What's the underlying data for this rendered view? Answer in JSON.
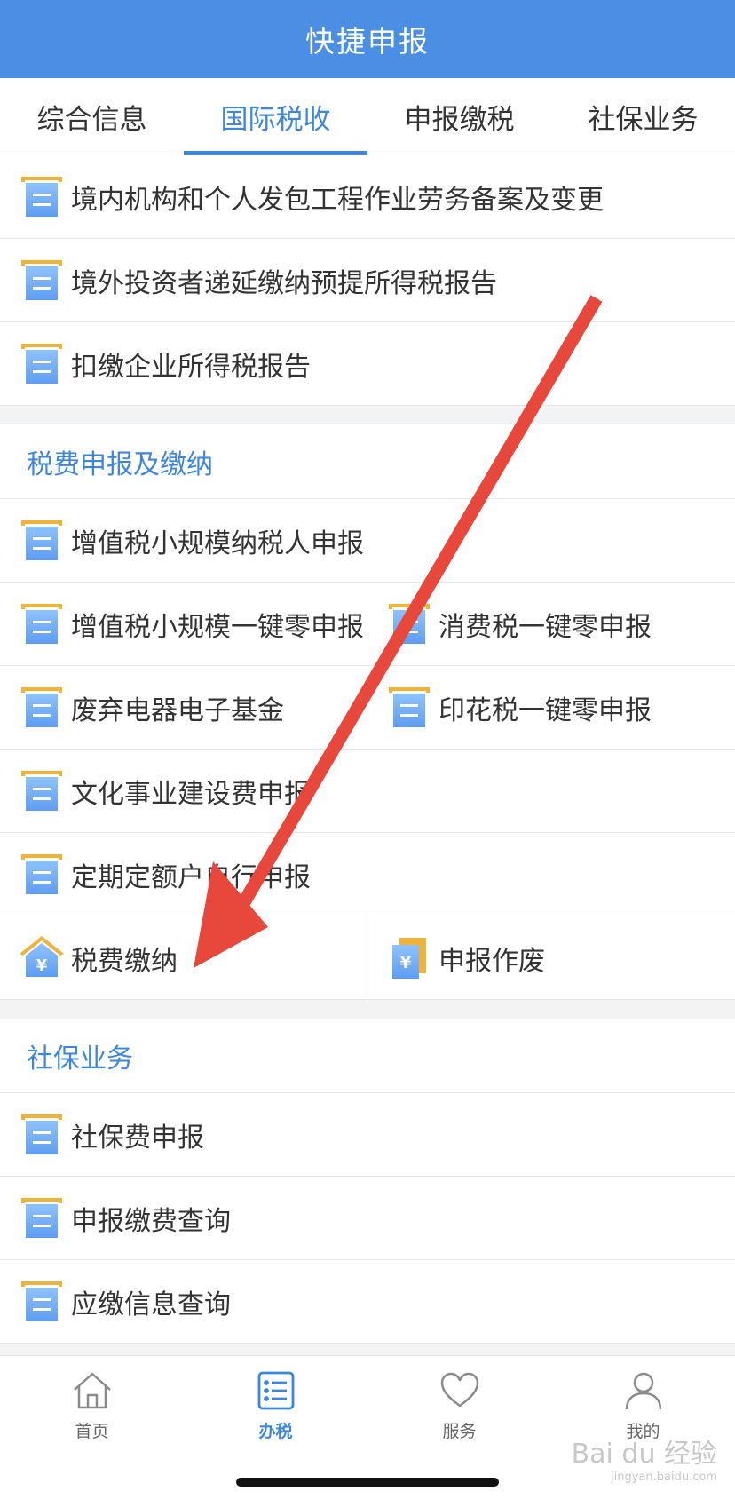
{
  "header": {
    "title": "快捷申报"
  },
  "tabs": [
    {
      "label": "综合信息",
      "active": false
    },
    {
      "label": "国际税收",
      "active": true
    },
    {
      "label": "申报缴税",
      "active": false
    },
    {
      "label": "社保业务",
      "active": false
    }
  ],
  "group1": {
    "items": [
      {
        "label": "境内机构和个人发包工程作业劳务备案及变更",
        "icon": "document-icon"
      },
      {
        "label": "境外投资者递延缴纳预提所得税报告",
        "icon": "document-icon"
      },
      {
        "label": "扣缴企业所得税报告",
        "icon": "document-icon"
      }
    ]
  },
  "group2": {
    "title": "税费申报及缴纳",
    "rows": [
      [
        {
          "label": "增值税小规模纳税人申报",
          "icon": "document-icon"
        }
      ],
      [
        {
          "label": "增值税小规模一键零申报",
          "icon": "document-icon"
        },
        {
          "label": "消费税一键零申报",
          "icon": "document-icon"
        }
      ],
      [
        {
          "label": "废弃电器电子基金",
          "icon": "document-icon"
        },
        {
          "label": "印花税一键零申报",
          "icon": "document-icon"
        }
      ],
      [
        {
          "label": "文化事业建设费申报",
          "icon": "document-icon"
        }
      ],
      [
        {
          "label": "定期定额户自行申报",
          "icon": "document-icon"
        }
      ],
      [
        {
          "label": "税费缴纳",
          "icon": "tax-payment-icon"
        },
        {
          "label": "申报作废",
          "icon": "void-declaration-icon"
        }
      ]
    ]
  },
  "group3": {
    "title": "社保业务",
    "items": [
      {
        "label": "社保费申报",
        "icon": "document-icon"
      },
      {
        "label": "申报缴费查询",
        "icon": "document-icon"
      },
      {
        "label": "应缴信息查询",
        "icon": "document-icon"
      }
    ]
  },
  "tabbar": [
    {
      "label": "首页",
      "icon": "home-icon",
      "active": false
    },
    {
      "label": "办税",
      "icon": "list-icon",
      "active": true
    },
    {
      "label": "服务",
      "icon": "heart-icon",
      "active": false
    },
    {
      "label": "我的",
      "icon": "person-icon",
      "active": false
    }
  ],
  "watermark": {
    "text": "Bai du 经验",
    "sub": "jingyan.baidu.com"
  },
  "colors": {
    "primary": "#4a8fe4",
    "accent": "#3d86e0",
    "annotation_arrow": "#e8473b",
    "icon_gold": "#f0b33a"
  }
}
